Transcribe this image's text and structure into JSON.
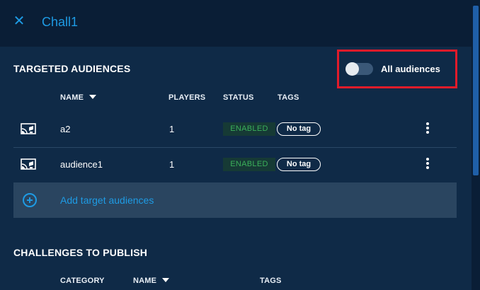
{
  "header": {
    "close_glyph": "✕",
    "title": "Chall1"
  },
  "audiences": {
    "section_title": "TARGETED AUDIENCES",
    "toggle_label": "All audiences",
    "toggle_on": false,
    "columns": {
      "name": "NAME",
      "players": "PLAYERS",
      "status": "STATUS",
      "tags": "TAGS"
    },
    "rows": [
      {
        "name": "a2",
        "players": "1",
        "status": "ENABLED",
        "tag": "No tag",
        "icon": "audience-icon"
      },
      {
        "name": "audience1",
        "players": "1",
        "status": "ENABLED",
        "tag": "No tag",
        "icon": "audience-icon"
      }
    ],
    "add_label": "Add target audiences"
  },
  "challenges": {
    "section_title": "CHALLENGES TO PUBLISH",
    "columns": {
      "category": "CATEGORY",
      "name": "NAME",
      "tags": "TAGS"
    }
  },
  "colors": {
    "accent": "#1e9be4",
    "status_enabled": "#3bb05a",
    "highlight": "#e21b2a"
  }
}
